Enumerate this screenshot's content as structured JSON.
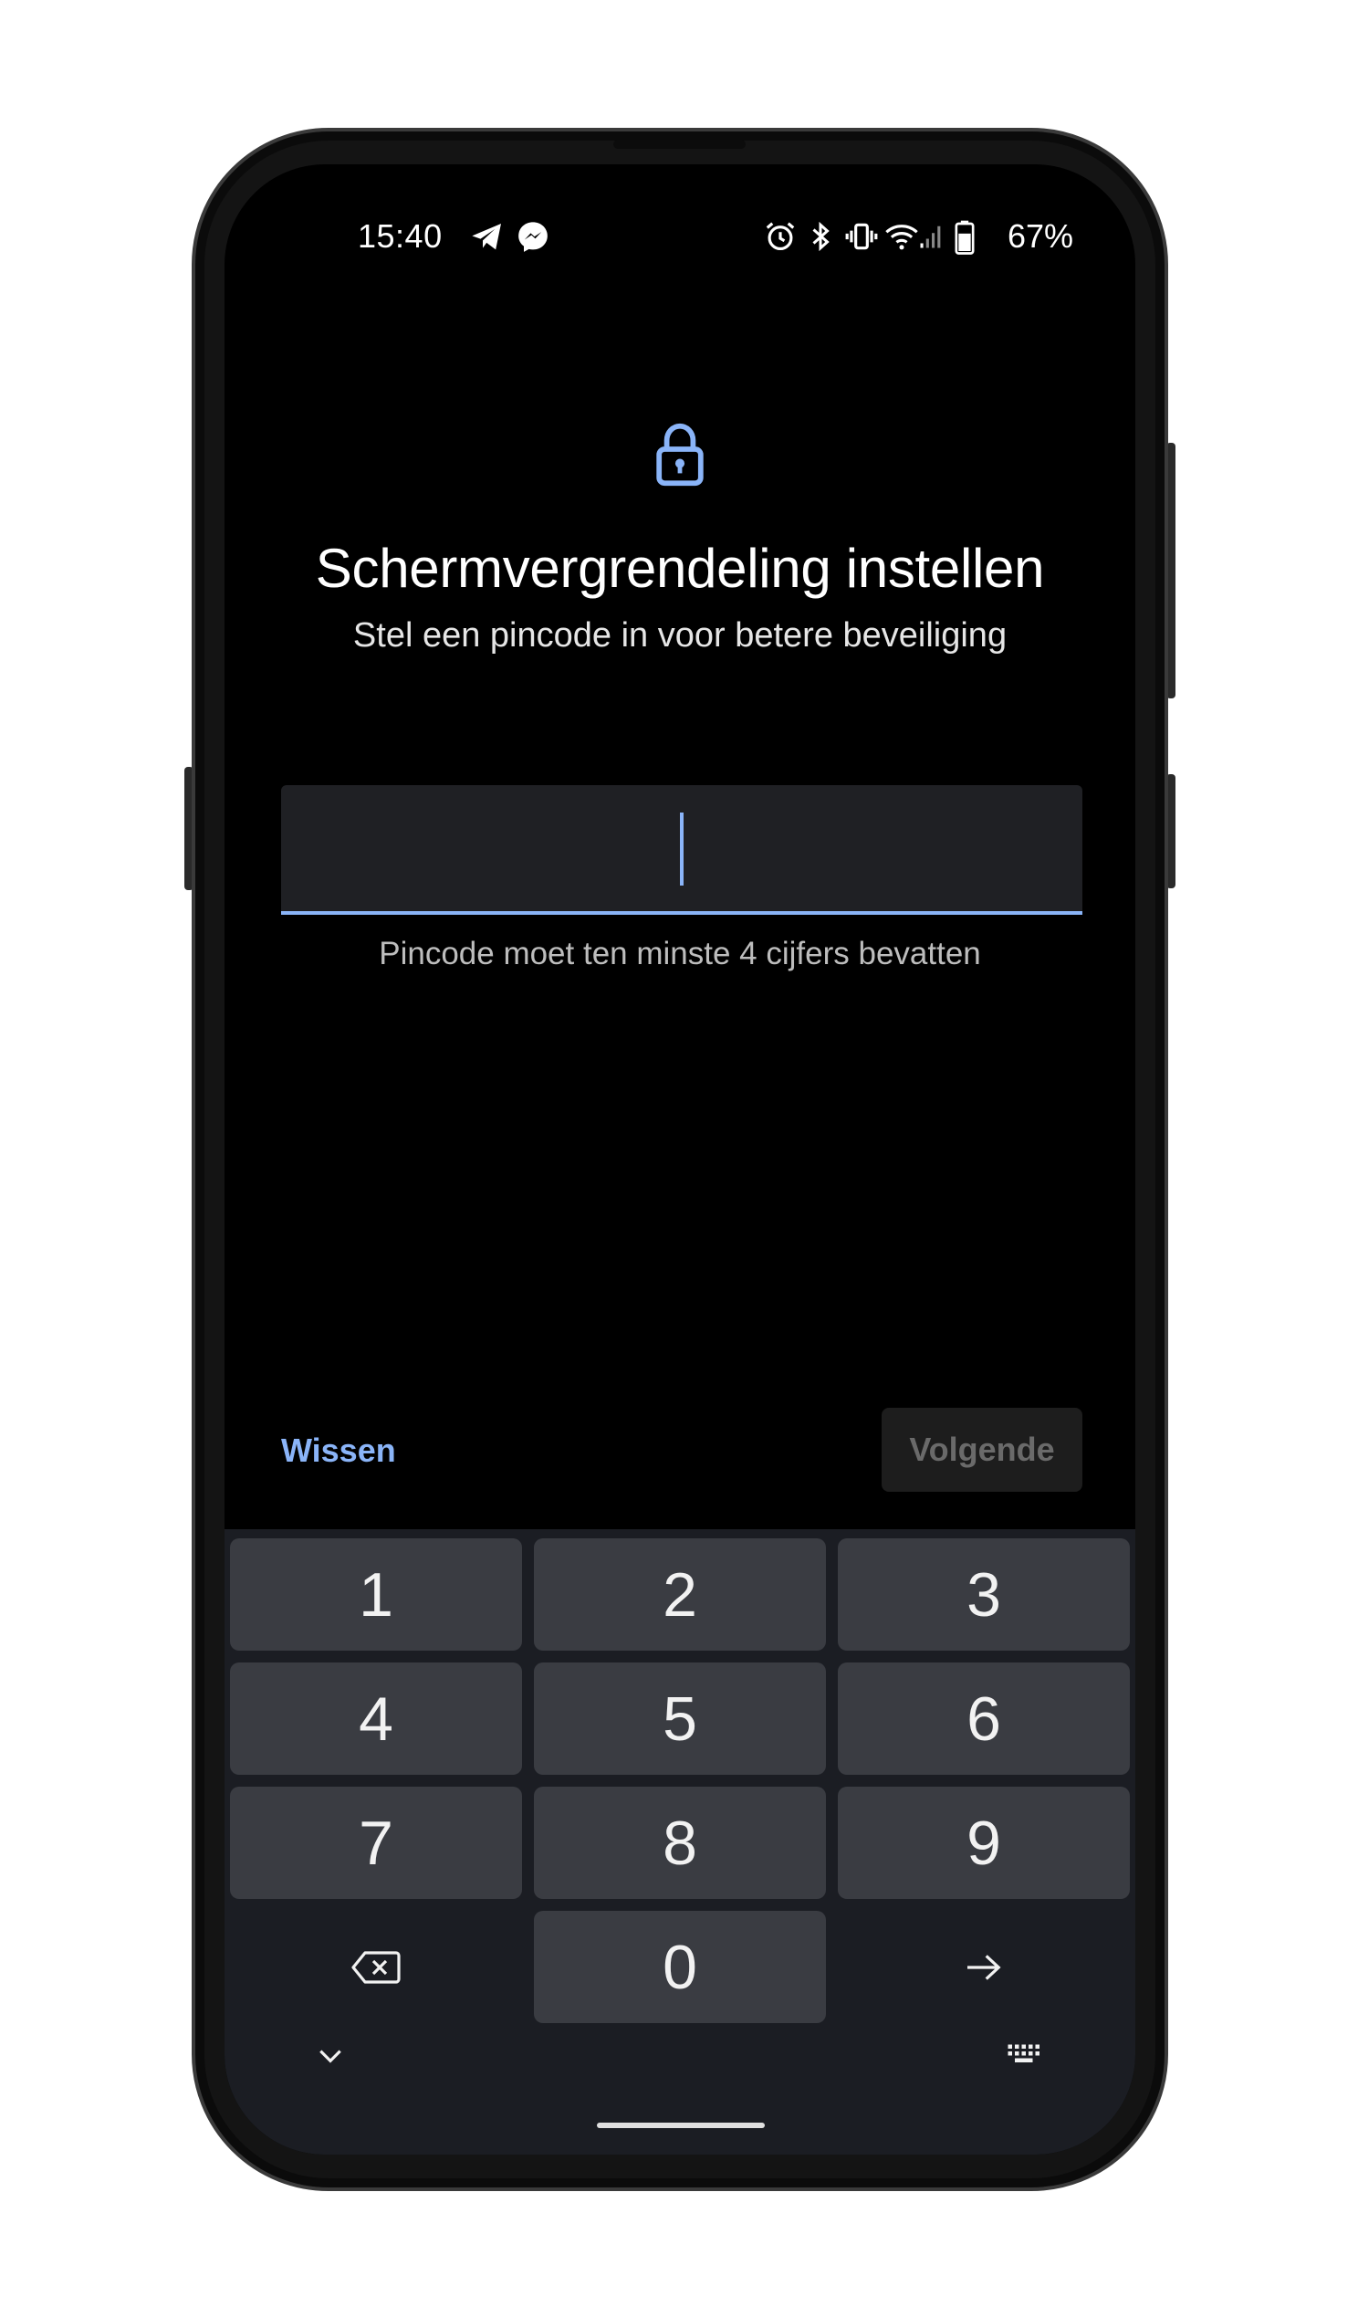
{
  "status_bar": {
    "time": "15:40",
    "battery": "67%",
    "icons": [
      "telegram-icon",
      "messenger-icon",
      "alarm-icon",
      "bluetooth-icon",
      "vibrate-icon",
      "wifi-icon",
      "signal-icon",
      "battery-icon"
    ]
  },
  "header": {
    "icon": "lock-icon",
    "title": "Schermvergrendeling instellen",
    "subtitle": "Stel een pincode in voor betere beveiliging"
  },
  "pin_input": {
    "value": "",
    "hint": "Pincode moet ten minste 4 cijfers bevatten"
  },
  "actions": {
    "clear_label": "Wissen",
    "next_label": "Volgende"
  },
  "keypad": {
    "keys": [
      "1",
      "2",
      "3",
      "4",
      "5",
      "6",
      "7",
      "8",
      "9",
      "0"
    ]
  },
  "colors": {
    "accent": "#8ab4f8",
    "background": "#000000",
    "keyboard": "#1b1d23",
    "key": "#3a3c42"
  }
}
